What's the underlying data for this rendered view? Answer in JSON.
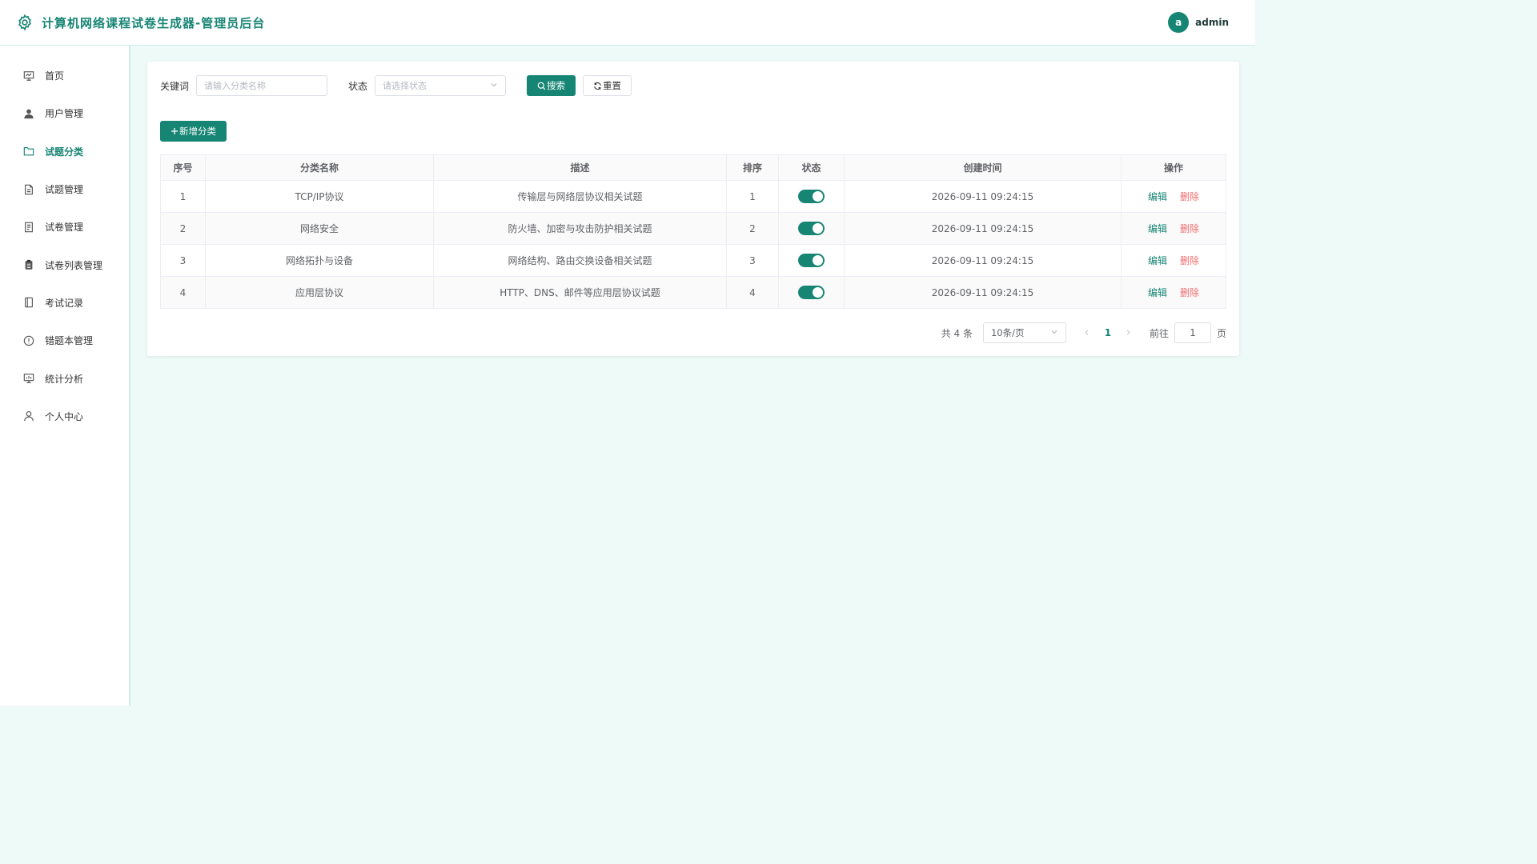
{
  "header": {
    "title": "计算机网络课程试卷生成器-管理员后台",
    "avatar_letter": "a",
    "username": "admin"
  },
  "sidebar": {
    "items": [
      {
        "label": "首页",
        "icon": "presentation-icon"
      },
      {
        "label": "用户管理",
        "icon": "user-icon"
      },
      {
        "label": "试题分类",
        "icon": "folder-icon",
        "active": true
      },
      {
        "label": "试题管理",
        "icon": "document-icon"
      },
      {
        "label": "试卷管理",
        "icon": "document-list-icon"
      },
      {
        "label": "试卷列表管理",
        "icon": "clipboard-icon"
      },
      {
        "label": "考试记录",
        "icon": "notebook-icon"
      },
      {
        "label": "错题本管理",
        "icon": "warning-circle-icon"
      },
      {
        "label": "统计分析",
        "icon": "chart-board-icon"
      },
      {
        "label": "个人中心",
        "icon": "person-icon"
      }
    ]
  },
  "filter": {
    "keyword_label": "关键词",
    "keyword_placeholder": "请输入分类名称",
    "status_label": "状态",
    "status_placeholder": "请选择状态",
    "search_label": "搜索",
    "reset_label": "重置"
  },
  "add_button_label": "新增分类",
  "table": {
    "headers": [
      "序号",
      "分类名称",
      "描述",
      "排序",
      "状态",
      "创建时间",
      "操作"
    ],
    "rows": [
      {
        "index": "1",
        "name": "TCP/IP协议",
        "desc": "传输层与网络层协议相关试题",
        "sort": "1",
        "enabled": true,
        "created": "2026-09-11 09:24:15"
      },
      {
        "index": "2",
        "name": "网络安全",
        "desc": "防火墙、加密与攻击防护相关试题",
        "sort": "2",
        "enabled": true,
        "created": "2026-09-11 09:24:15"
      },
      {
        "index": "3",
        "name": "网络拓扑与设备",
        "desc": "网络结构、路由交换设备相关试题",
        "sort": "3",
        "enabled": true,
        "created": "2026-09-11 09:24:15"
      },
      {
        "index": "4",
        "name": "应用层协议",
        "desc": "HTTP、DNS、邮件等应用层协议试题",
        "sort": "4",
        "enabled": true,
        "created": "2026-09-11 09:24:15"
      }
    ],
    "edit_label": "编辑",
    "delete_label": "删除"
  },
  "pager": {
    "total_text": "共 4 条",
    "page_size": "10条/页",
    "current_page": "1",
    "goto_label": "前往",
    "goto_value": "1",
    "page_suffix": "页"
  },
  "colors": {
    "accent": "#178574",
    "danger": "#f56c6c",
    "background": "#eefaf7"
  }
}
